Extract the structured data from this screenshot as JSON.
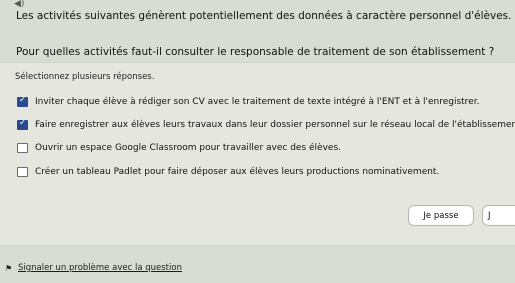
{
  "question": {
    "line1": "Les activités suivantes génèrent potentiellement des données à caractère personnel d'élèves.",
    "line2": "Pour quelles activités faut-il consulter le responsable de traitement de son établissement ?"
  },
  "hint": "Sélectionnez plusieurs réponses.",
  "options": [
    {
      "label": "Inviter chaque élève à rédiger son CV avec le traitement de texte intégré à l'ENT et à l'enregistrer.",
      "checked": true
    },
    {
      "label": "Faire enregistrer aux élèves leurs travaux dans leur dossier personnel sur le réseau local de l'établissement.",
      "checked": true
    },
    {
      "label": "Ouvrir un espace Google Classroom pour travailler avec des élèves.",
      "checked": false
    },
    {
      "label": "Créer un tableau Padlet pour faire déposer aux élèves leurs productions nominativement.",
      "checked": false
    }
  ],
  "buttons": {
    "skip": "Je passe",
    "next": "J"
  },
  "footer": {
    "report": "Signaler un problème avec la question"
  },
  "icons": {
    "speaker": "speaker-icon",
    "flag": "flag-icon"
  },
  "colors": {
    "checked": "#2a4a8f"
  }
}
